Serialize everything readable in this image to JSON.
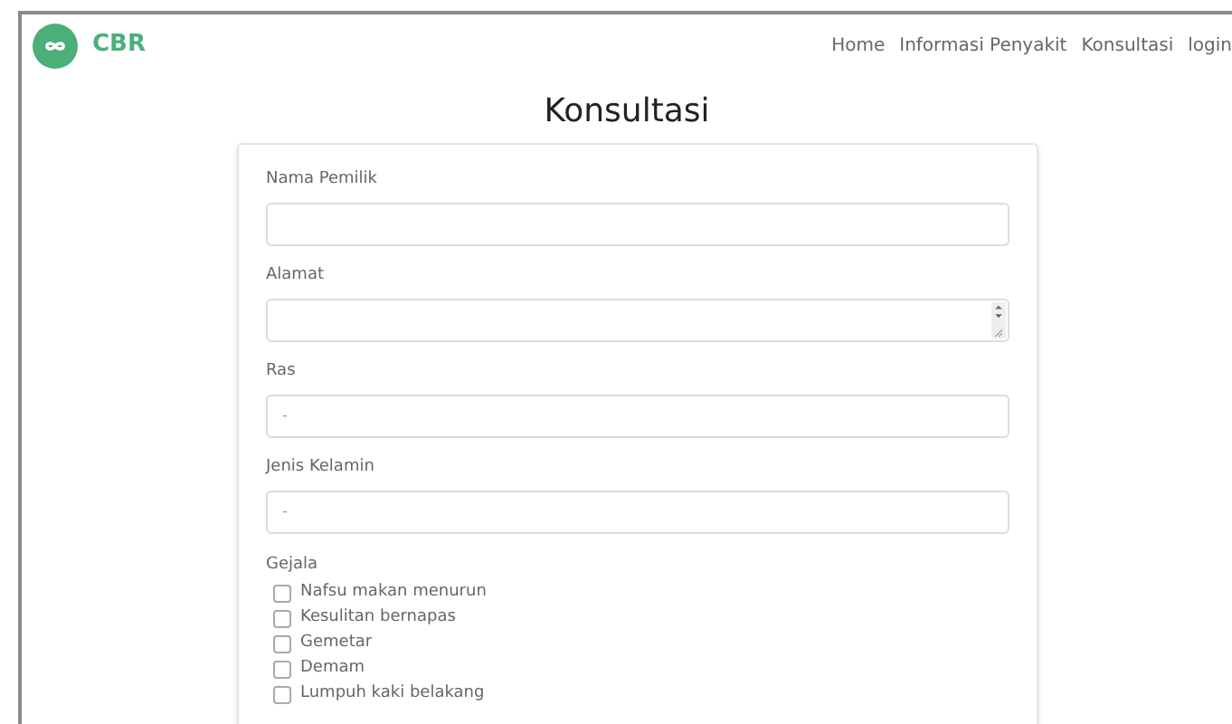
{
  "navbar": {
    "brand": "CBR",
    "links": [
      {
        "label": "Home"
      },
      {
        "label": "Informasi Penyakit"
      },
      {
        "label": "Konsultasi"
      },
      {
        "label": "login"
      }
    ]
  },
  "title": "Konsultasi",
  "form": {
    "fields": [
      {
        "label": "Nama Pemilik",
        "kind": "text"
      },
      {
        "label": "Alamat",
        "kind": "textarea"
      },
      {
        "label": "Ras",
        "kind": "select",
        "value": "-"
      },
      {
        "label": "Jenis Kelamin",
        "kind": "select",
        "value": "-"
      }
    ],
    "symptoms_label": "Gejala",
    "symptoms": [
      {
        "label": "Nafsu makan menurun",
        "checked": false
      },
      {
        "label": "Kesulitan bernapas",
        "checked": false
      },
      {
        "label": "Gemetar",
        "checked": false
      },
      {
        "label": "Demam",
        "checked": false
      },
      {
        "label": "Lumpuh kaki belakang",
        "checked": false
      }
    ]
  }
}
